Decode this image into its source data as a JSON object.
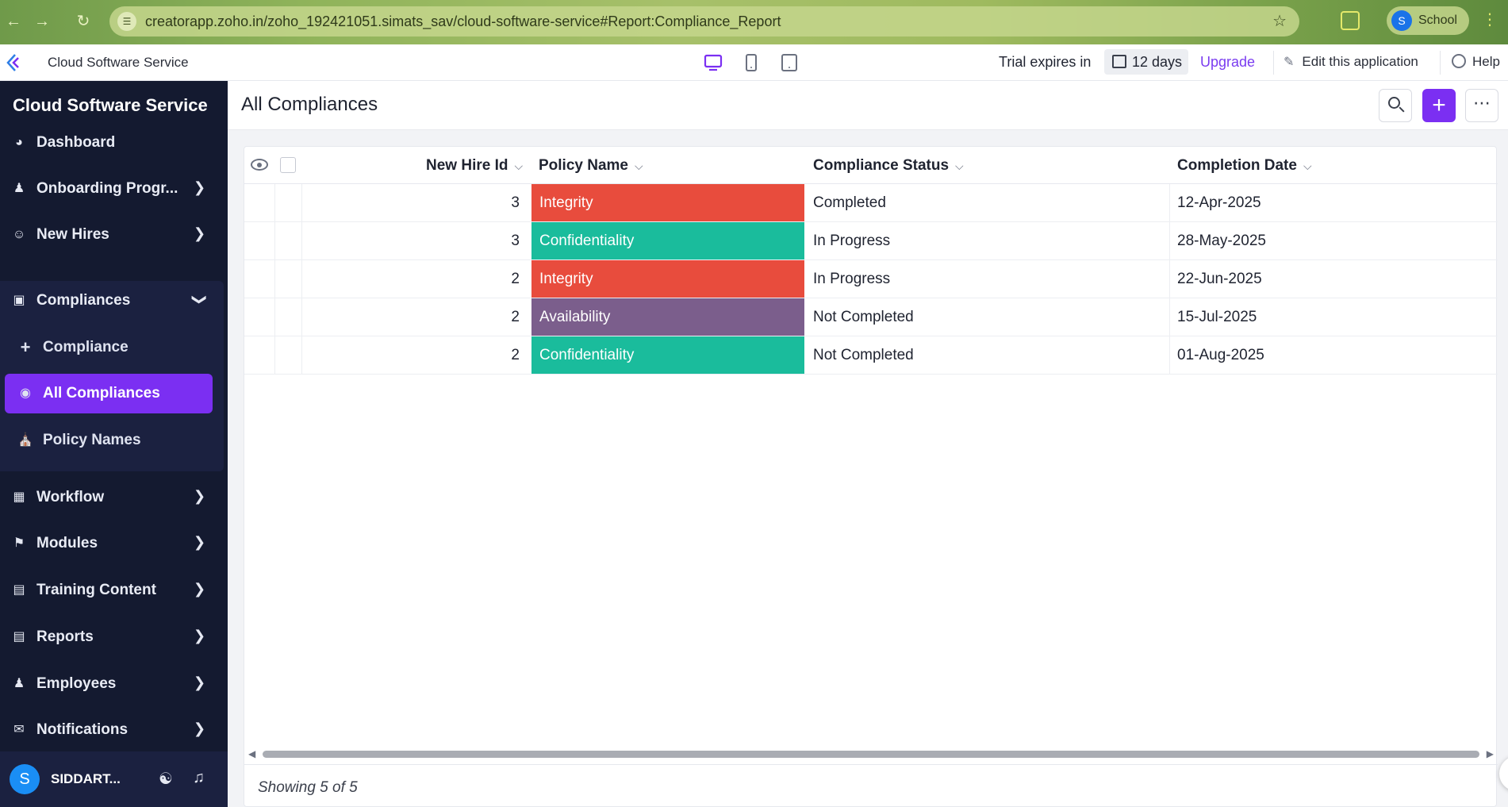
{
  "browser": {
    "url": "creatorapp.zoho.in/zoho_192421051.simats_sav/cloud-software-service#Report:Compliance_Report",
    "profile_initial": "S",
    "profile_name": "School"
  },
  "header": {
    "app_name": "Cloud Software Service",
    "trial_text": "Trial expires in",
    "trial_days": "12 days",
    "upgrade_label": "Upgrade",
    "edit_label": "Edit this application",
    "help_label": "Help"
  },
  "sidebar": {
    "title": "Cloud Software Service",
    "items": [
      {
        "label": "Dashboard",
        "icon": "dashboard-icon"
      },
      {
        "label": "Onboarding Progr...",
        "icon": "person-icon"
      },
      {
        "label": "New Hires",
        "icon": "face-icon"
      },
      {
        "label": "Compliances",
        "icon": "monitor-icon"
      },
      {
        "label": "Workflow",
        "icon": "workflow-icon"
      },
      {
        "label": "Modules",
        "icon": "flag-icon"
      },
      {
        "label": "Training Content",
        "icon": "content-icon"
      },
      {
        "label": "Reports",
        "icon": "chart-icon"
      },
      {
        "label": "Employees",
        "icon": "user-icon"
      },
      {
        "label": "Notifications",
        "icon": "mail-icon"
      }
    ],
    "sub_items": [
      {
        "label": "Compliance",
        "icon": "plus-icon"
      },
      {
        "label": "All Compliances",
        "icon": "globe-icon"
      },
      {
        "label": "Policy Names",
        "icon": "badge-icon"
      }
    ],
    "user": {
      "initial": "S",
      "name": "SIDDART..."
    }
  },
  "main": {
    "title": "All Compliances",
    "columns": [
      "New Hire Id",
      "Policy Name",
      "Compliance Status",
      "Completion Date"
    ],
    "rows": [
      {
        "id": "3",
        "policy": "Integrity",
        "status": "Completed",
        "date": "12-Apr-2025"
      },
      {
        "id": "3",
        "policy": "Confidentiality",
        "status": "In Progress",
        "date": "28-May-2025"
      },
      {
        "id": "2",
        "policy": "Integrity",
        "status": "In Progress",
        "date": "22-Jun-2025"
      },
      {
        "id": "2",
        "policy": "Availability",
        "status": "Not Completed",
        "date": "15-Jul-2025"
      },
      {
        "id": "2",
        "policy": "Confidentiality",
        "status": "Not Completed",
        "date": "01-Aug-2025"
      }
    ],
    "policy_colors": {
      "Integrity": "#e84c3d",
      "Confidentiality": "#1abc9c",
      "Availability": "#7b5e8c"
    },
    "footer_text": "Showing 5 of 5"
  },
  "colors": {
    "sidebar_bg": "#141a30",
    "accent": "#7b2ff2",
    "upgrade": "#7a3cf0"
  }
}
